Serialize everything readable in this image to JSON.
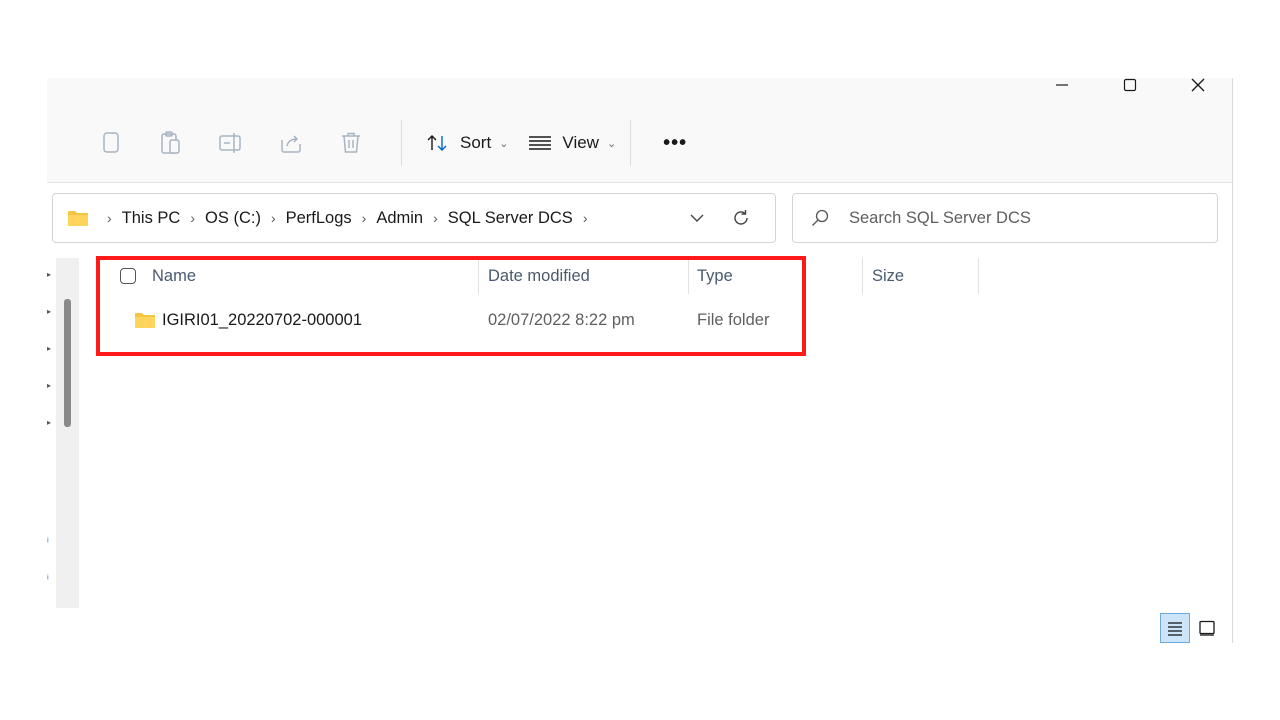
{
  "window_controls": {
    "minimize": "—",
    "maximize": "☐",
    "close": "✕"
  },
  "toolbar": {
    "icons": [
      "copy-icon",
      "paste-icon",
      "rename-icon",
      "share-icon",
      "delete-icon"
    ],
    "sort_label": "Sort",
    "view_label": "View",
    "more_label": "•••"
  },
  "address": {
    "crumbs": [
      "This PC",
      "OS (C:)",
      "PerfLogs",
      "Admin",
      "SQL Server DCS"
    ]
  },
  "search": {
    "placeholder": "Search SQL Server DCS"
  },
  "columns": {
    "name": "Name",
    "date": "Date modified",
    "type": "Type",
    "size": "Size"
  },
  "rows": [
    {
      "name": "IGIRI01_20220702-000001",
      "date": "02/07/2022 8:22 pm",
      "type": "File folder",
      "size": ""
    }
  ],
  "colors": {
    "highlight": "#ff1a1a",
    "folder": "#f4c542",
    "accent": "#0067c0"
  }
}
